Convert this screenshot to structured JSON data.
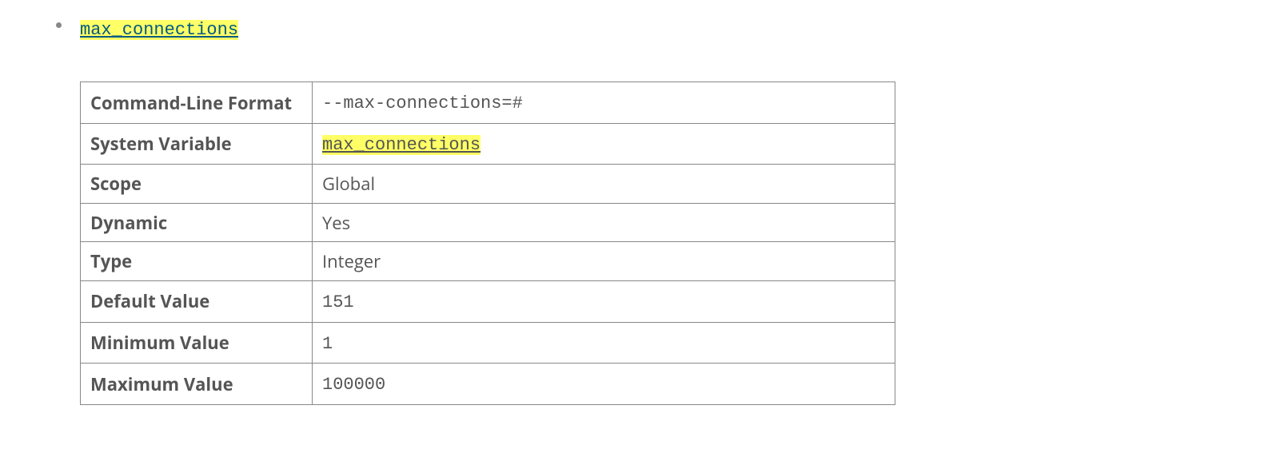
{
  "variable": {
    "name": "max_connections"
  },
  "table": {
    "rows": [
      {
        "label": "Command-Line Format",
        "value": "--max-connections=#",
        "code": true
      },
      {
        "label": "System Variable",
        "value": "max_connections",
        "code": true,
        "highlight": true,
        "link": true
      },
      {
        "label": "Scope",
        "value": "Global"
      },
      {
        "label": "Dynamic",
        "value": "Yes"
      },
      {
        "label": "Type",
        "value": "Integer"
      },
      {
        "label": "Default Value",
        "value": "151",
        "code": true
      },
      {
        "label": "Minimum Value",
        "value": "1",
        "code": true
      },
      {
        "label": "Maximum Value",
        "value": "100000",
        "code": true
      }
    ]
  }
}
